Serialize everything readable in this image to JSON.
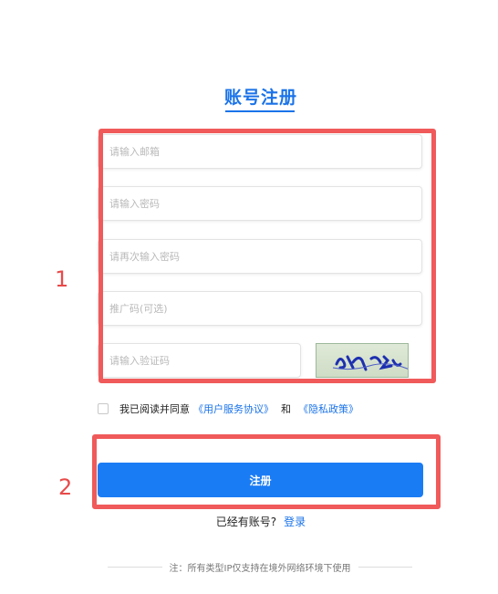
{
  "title": "账号注册",
  "fields": {
    "email_placeholder": "请输入邮箱",
    "password_placeholder": "请输入密码",
    "confirm_placeholder": "请再次输入密码",
    "referral_placeholder": "推广码(可选)",
    "captcha_placeholder": "请输入验证码"
  },
  "agreement": {
    "prefix": "我已阅读并同意",
    "terms_link": "《用户服务协议》",
    "and": "和",
    "privacy_link": "《隐私政策》"
  },
  "register_label": "注册",
  "login_prompt": "已经有账号?",
  "login_link": "登录",
  "note": "注：所有类型IP仅支持在境外网络环境下使用",
  "annotations": [
    "1",
    "2"
  ],
  "colors": {
    "accent": "#1a7cf5",
    "annotation": "#f05a5a"
  }
}
